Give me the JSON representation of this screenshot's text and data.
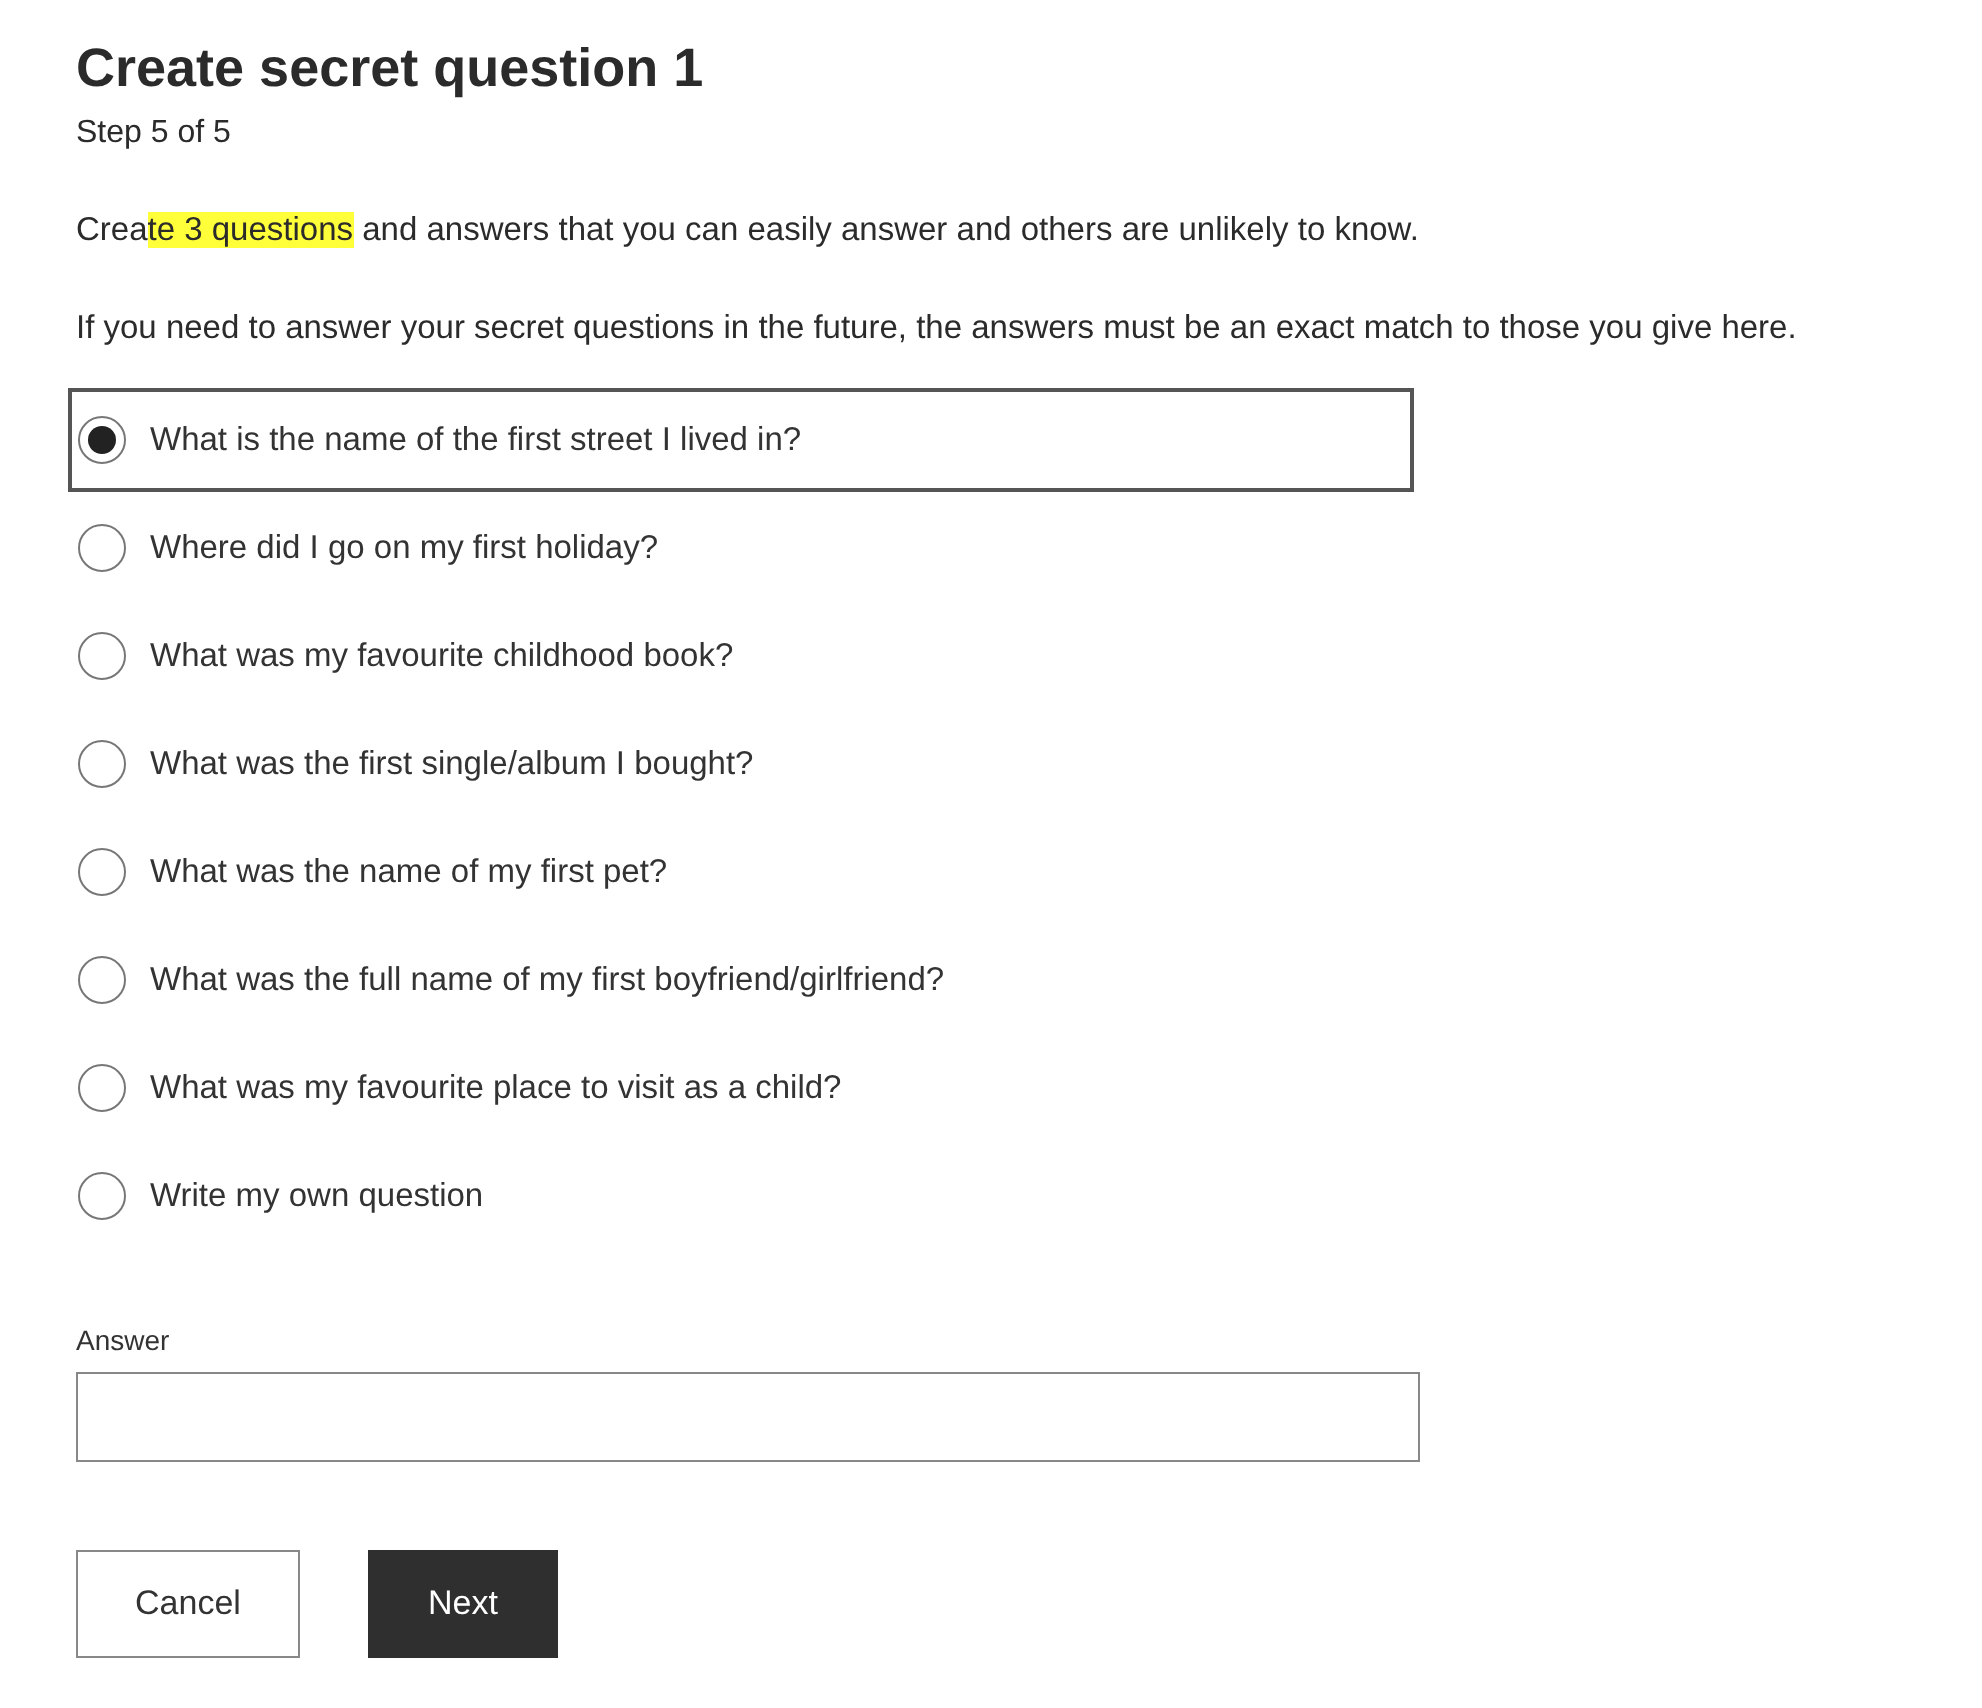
{
  "title": "Create secret question 1",
  "step": "Step 5 of 5",
  "intro": [
    {
      "text": "Crea",
      "highlighted": false
    },
    {
      "text": "te 3 questions",
      "highlighted": true
    },
    {
      "text": " and answers that you can easily answer and others are unlikely to know.",
      "highlighted": false
    }
  ],
  "note": "If you need to answer your secret questions in the future, the answers must be an exact match to those you give here.",
  "questions": [
    {
      "label": "What is the name of the first street I lived in?",
      "selected": true
    },
    {
      "label": "Where did I go on my first holiday?",
      "selected": false
    },
    {
      "label": "What was my favourite childhood book?",
      "selected": false
    },
    {
      "label": "What was the first single/album I bought?",
      "selected": false
    },
    {
      "label": "What was the name of my first pet?",
      "selected": false
    },
    {
      "label": "What was the full name of my first boyfriend/girlfriend?",
      "selected": false
    },
    {
      "label": "What was my favourite place to visit as a child?",
      "selected": false
    },
    {
      "label": "Write my own question",
      "selected": false
    }
  ],
  "answer": {
    "label": "Answer"
  },
  "buttons": [
    {
      "label": "Cancel",
      "kind": "secondary"
    },
    {
      "label": "Next",
      "kind": "primary"
    }
  ]
}
